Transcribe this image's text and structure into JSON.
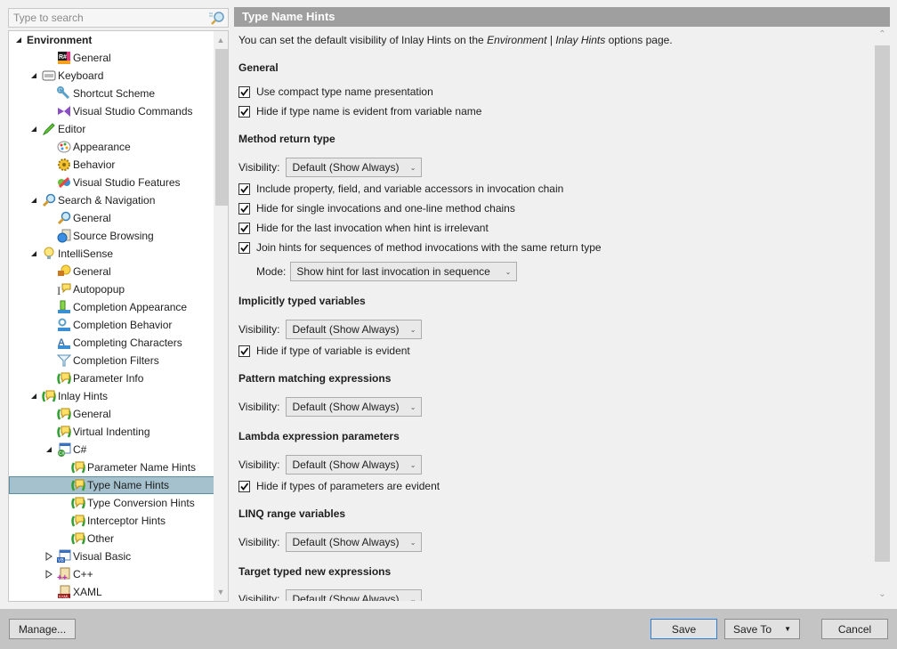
{
  "search": {
    "placeholder": "Type to search",
    "value": ""
  },
  "tree": {
    "items": [
      {
        "label": "Environment",
        "level": 0,
        "toggle": "expanded",
        "icon": "none",
        "bold": true
      },
      {
        "label": "General",
        "level": 2,
        "toggle": "none",
        "icon": "resharper-icon"
      },
      {
        "label": "Keyboard",
        "level": 1,
        "toggle": "expanded",
        "icon": "keyboard-icon"
      },
      {
        "label": "Shortcut Scheme",
        "level": 2,
        "toggle": "none",
        "icon": "wrench-icon"
      },
      {
        "label": "Visual Studio Commands",
        "level": 2,
        "toggle": "none",
        "icon": "visual-studio-icon"
      },
      {
        "label": "Editor",
        "level": 1,
        "toggle": "expanded",
        "icon": "pencil-icon"
      },
      {
        "label": "Appearance",
        "level": 2,
        "toggle": "none",
        "icon": "palette-icon"
      },
      {
        "label": "Behavior",
        "level": 2,
        "toggle": "none",
        "icon": "gear-icon"
      },
      {
        "label": "Visual Studio Features",
        "level": 2,
        "toggle": "none",
        "icon": "features-icon"
      },
      {
        "label": "Search & Navigation",
        "level": 1,
        "toggle": "expanded",
        "icon": "magnifier-icon"
      },
      {
        "label": "General",
        "level": 2,
        "toggle": "none",
        "icon": "magnifier-icon"
      },
      {
        "label": "Source Browsing",
        "level": 2,
        "toggle": "none",
        "icon": "globe-document-icon"
      },
      {
        "label": "IntelliSense",
        "level": 1,
        "toggle": "expanded",
        "icon": "lightbulb-icon"
      },
      {
        "label": "General",
        "level": 2,
        "toggle": "none",
        "icon": "plug-bulb-icon"
      },
      {
        "label": "Autopopup",
        "level": 2,
        "toggle": "none",
        "icon": "autopopup-icon"
      },
      {
        "label": "Completion Appearance",
        "level": 2,
        "toggle": "none",
        "icon": "completion-appearance-icon"
      },
      {
        "label": "Completion Behavior",
        "level": 2,
        "toggle": "none",
        "icon": "completion-behavior-icon"
      },
      {
        "label": "Completing Characters",
        "level": 2,
        "toggle": "none",
        "icon": "completing-characters-icon"
      },
      {
        "label": "Completion Filters",
        "level": 2,
        "toggle": "none",
        "icon": "filter-icon"
      },
      {
        "label": "Parameter Info",
        "level": 2,
        "toggle": "none",
        "icon": "inlay-hint-icon"
      },
      {
        "label": "Inlay Hints",
        "level": 1,
        "toggle": "expanded",
        "icon": "inlay-hint-icon"
      },
      {
        "label": "General",
        "level": 2,
        "toggle": "none",
        "icon": "inlay-hint-icon"
      },
      {
        "label": "Virtual Indenting",
        "level": 2,
        "toggle": "none",
        "icon": "inlay-hint-icon"
      },
      {
        "label": "C#",
        "level": 2,
        "toggle": "expanded",
        "icon": "csharp-icon"
      },
      {
        "label": "Parameter Name Hints",
        "level": 3,
        "toggle": "none",
        "icon": "inlay-hint-icon"
      },
      {
        "label": "Type Name Hints",
        "level": 3,
        "toggle": "none",
        "icon": "inlay-hint-icon",
        "selected": true
      },
      {
        "label": "Type Conversion Hints",
        "level": 3,
        "toggle": "none",
        "icon": "inlay-hint-icon"
      },
      {
        "label": "Interceptor Hints",
        "level": 3,
        "toggle": "none",
        "icon": "inlay-hint-icon"
      },
      {
        "label": "Other",
        "level": 3,
        "toggle": "none",
        "icon": "inlay-hint-icon"
      },
      {
        "label": "Visual Basic",
        "level": 2,
        "toggle": "collapsed",
        "icon": "vb-icon"
      },
      {
        "label": "C++",
        "level": 2,
        "toggle": "collapsed",
        "icon": "cpp-icon"
      },
      {
        "label": "XAML",
        "level": 2,
        "toggle": "none",
        "icon": "xaml-icon"
      }
    ]
  },
  "page": {
    "title": "Type Name Hints",
    "intro_prefix": "You can set the default visibility of Inlay Hints on the ",
    "intro_link": "Environment | Inlay Hints",
    "intro_suffix": " options page.",
    "visibility_label": "Visibility:",
    "mode_label": "Mode:",
    "sections": {
      "general": {
        "title": "General",
        "checkboxes": [
          {
            "label": "Use compact type name presentation",
            "checked": true
          },
          {
            "label": "Hide if type name is evident from variable name",
            "checked": true
          }
        ]
      },
      "method_return": {
        "title": "Method return type",
        "visibility": "Default (Show Always)",
        "checkboxes": [
          {
            "label": "Include property, field, and variable accessors in invocation chain",
            "checked": true
          },
          {
            "label": "Hide for single invocations and one-line method chains",
            "checked": true
          },
          {
            "label": "Hide for the last invocation when hint is irrelevant",
            "checked": true
          },
          {
            "label": "Join hints for sequences of method invocations with the same return type",
            "checked": true
          }
        ],
        "mode": "Show hint for last invocation in sequence"
      },
      "implicit_vars": {
        "title": "Implicitly typed variables",
        "visibility": "Default (Show Always)",
        "checkboxes": [
          {
            "label": "Hide if type of variable is evident",
            "checked": true
          }
        ]
      },
      "pattern": {
        "title": "Pattern matching expressions",
        "visibility": "Default (Show Always)"
      },
      "lambda": {
        "title": "Lambda expression parameters",
        "visibility": "Default (Show Always)",
        "checkboxes": [
          {
            "label": "Hide if types of parameters are evident",
            "checked": true
          }
        ]
      },
      "linq": {
        "title": "LINQ range variables",
        "visibility": "Default (Show Always)"
      },
      "target_typed": {
        "title": "Target typed new expressions",
        "visibility": "Default (Show Always)"
      }
    }
  },
  "footer": {
    "manage_label": "Manage...",
    "save_label": "Save",
    "save_to_label": "Save To",
    "cancel_label": "Cancel"
  },
  "colors": {
    "header_bg": "#9f9f9f",
    "selection_bg": "#a5c1cd",
    "selection_border": "#5c8ea3",
    "footer_bg": "#c4c4c4",
    "default_button_border": "#2f7fd6"
  }
}
